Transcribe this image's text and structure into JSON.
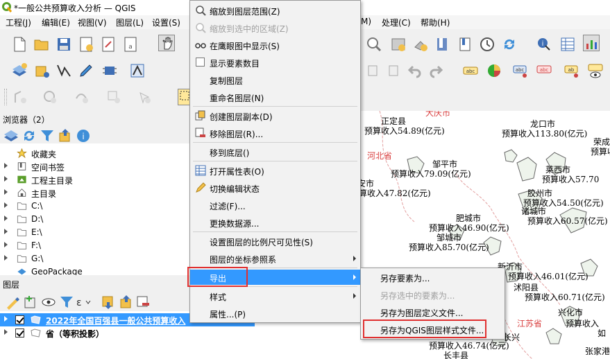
{
  "window": {
    "title": "*一般公共预算收入分析 — QGIS"
  },
  "menubar": {
    "items": [
      "工程(J)",
      "编辑(E)",
      "视图(V)",
      "图层(L)",
      "设置(S)",
      "M)",
      "处理(C)",
      "帮助(H)"
    ]
  },
  "browser_panel": {
    "title": "浏览器（2）",
    "items": [
      {
        "label": "收藏夹",
        "icon": "star-icon"
      },
      {
        "label": "空间书签",
        "icon": "bookmark-icon"
      },
      {
        "label": "工程主目录",
        "icon": "project-home-icon"
      },
      {
        "label": "主目录",
        "icon": "home-icon"
      },
      {
        "label": "C:\\",
        "icon": "folder-icon"
      },
      {
        "label": "D:\\",
        "icon": "folder-icon"
      },
      {
        "label": "E:\\",
        "icon": "folder-icon"
      },
      {
        "label": "F:\\",
        "icon": "folder-icon"
      },
      {
        "label": "G:\\",
        "icon": "folder-icon"
      },
      {
        "label": "GeoPackage",
        "icon": "geopackage-icon"
      }
    ]
  },
  "layers_panel": {
    "title": "图层",
    "layers": [
      {
        "name": "2022年全国百强县一般公共预算收入",
        "checked": true,
        "selected": true
      },
      {
        "name": "省（等积投影）",
        "checked": true,
        "selected": false
      }
    ]
  },
  "context_menu": {
    "items": [
      {
        "label": "缩放到图层范围(Z)",
        "icon": "zoom-layer-icon",
        "disabled": false
      },
      {
        "label": "缩放到选中的区域(Z)",
        "icon": "zoom-selection-icon",
        "disabled": true
      },
      {
        "label": "在鹰眼图中显示(S)",
        "icon": "overview-icon",
        "disabled": false
      },
      {
        "label": "显示要素数目",
        "icon": "checkbox-icon",
        "disabled": false
      },
      {
        "label": "复制图层",
        "icon": "",
        "disabled": false
      },
      {
        "label": "重命名图层(N)",
        "icon": "",
        "disabled": false
      },
      {
        "label": "创建图层副本(D)",
        "icon": "duplicate-icon",
        "disabled": false
      },
      {
        "label": "移除图层(R)...",
        "icon": "remove-layer-icon",
        "disabled": false
      },
      {
        "label": "移到底层()",
        "icon": "",
        "disabled": false
      },
      {
        "label": "打开属性表(O)",
        "icon": "attribute-table-icon",
        "disabled": false
      },
      {
        "label": "切换编辑状态",
        "icon": "pencil-icon",
        "disabled": false
      },
      {
        "label": "过滤(F)...",
        "icon": "",
        "disabled": false
      },
      {
        "label": "更换数据源...",
        "icon": "",
        "disabled": false
      },
      {
        "label": "设置图层的比例尺可见性(S)",
        "icon": "",
        "disabled": false
      },
      {
        "label": "图层的坐标参照系",
        "icon": "",
        "disabled": false,
        "submenu": true
      },
      {
        "label": "导出",
        "icon": "",
        "disabled": false,
        "submenu": true,
        "active": true
      },
      {
        "label": "样式",
        "icon": "",
        "disabled": false,
        "submenu": true
      },
      {
        "label": "属性...(P)",
        "icon": "",
        "disabled": false
      }
    ]
  },
  "export_submenu": {
    "items": [
      {
        "label": "另存要素为...",
        "disabled": false
      },
      {
        "label": "另存选中的要素为...",
        "disabled": true
      },
      {
        "label": "另存为图层定义文件...",
        "disabled": false
      },
      {
        "label": "另存为QGIS图层样式文件...",
        "disabled": false,
        "highlighted": true
      }
    ]
  },
  "map": {
    "labels": [
      {
        "text": "大庆市",
        "red": true
      },
      {
        "text": "正定县",
        "red": false
      },
      {
        "text": "预算收入54.89(亿元)",
        "red": false
      },
      {
        "text": "龙口市",
        "red": false
      },
      {
        "text": "预算收入113.80(亿元)",
        "red": false
      },
      {
        "text": "荣成",
        "red": false
      },
      {
        "text": "预算收入",
        "red": false
      },
      {
        "text": "河北省",
        "red": true
      },
      {
        "text": "邹平市",
        "red": false
      },
      {
        "text": "预算收入79.09(亿元)",
        "red": false
      },
      {
        "text": "莱西市",
        "red": false
      },
      {
        "text": "预算收入57.70",
        "red": false
      },
      {
        "text": "安市",
        "red": false
      },
      {
        "text": "预算收入47.82(亿元)",
        "red": false
      },
      {
        "text": "胶州市",
        "red": false
      },
      {
        "text": "预算收入54.50(亿元)",
        "red": false
      },
      {
        "text": "肥城市",
        "red": false
      },
      {
        "text": "诸城市",
        "red": false
      },
      {
        "text": "预算收入60.57(亿元)",
        "red": false
      },
      {
        "text": "预算收入46.90(亿元)",
        "red": false
      },
      {
        "text": "邹城市",
        "red": false
      },
      {
        "text": "预算收入85.70(亿元)",
        "red": false
      },
      {
        "text": "新沂市",
        "red": false
      },
      {
        "text": "预算收入46.01(亿元)",
        "red": false
      },
      {
        "text": "沭阳县",
        "red": false
      },
      {
        "text": "预算收入60.71(亿元)",
        "red": false
      },
      {
        "text": "兴化市",
        "red": false
      },
      {
        "text": "江苏省",
        "red": true
      },
      {
        "text": "预算收入",
        "red": false
      },
      {
        "text": "如",
        "red": false
      },
      {
        "text": "预算收入46.74(亿元)",
        "red": false
      },
      {
        "text": "长丰县",
        "red": false
      },
      {
        "text": "张家港",
        "red": false
      },
      {
        "text": "长兴",
        "red": false
      }
    ]
  },
  "colors": {
    "highlight": "#3399ff",
    "annotation_red": "#e03030",
    "map_boundary_red": "#d94040"
  }
}
